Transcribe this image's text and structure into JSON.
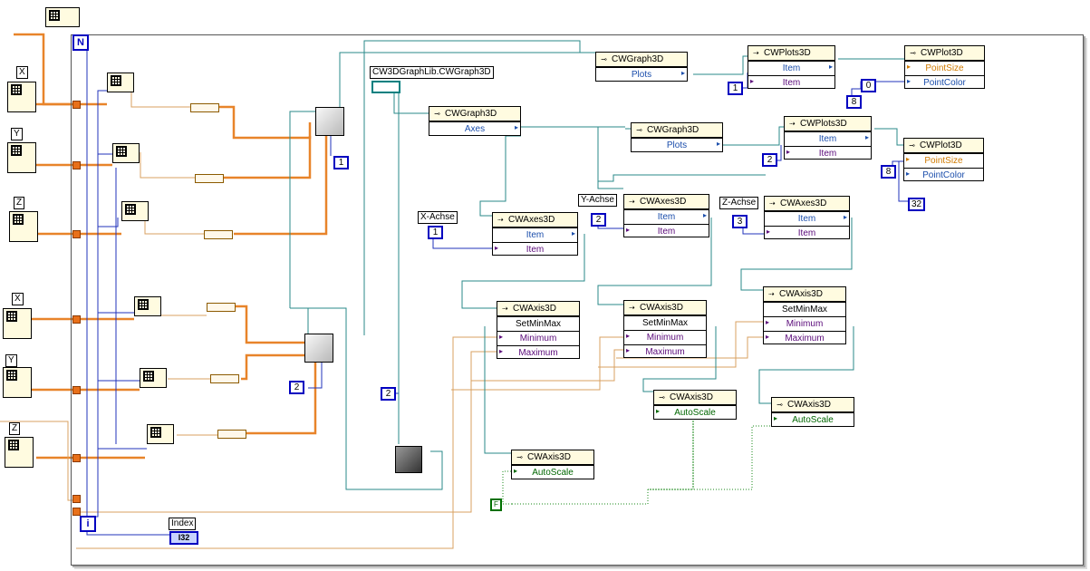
{
  "loop": {
    "count_terminal": "N",
    "iteration_terminal": "i"
  },
  "graph_ref_label": "CW3DGraphLib.CWGraph3D",
  "top_nodes": [
    {
      "class": "CWGraph3D",
      "prop": "Plots"
    },
    {
      "class": "CWPlots3D",
      "props": [
        "Item",
        "Item"
      ]
    },
    {
      "class": "CWPlot3D",
      "props": [
        "PointSize",
        "PointColor"
      ]
    },
    {
      "class": "CWGraph3D",
      "prop": "Plots"
    },
    {
      "class": "CWPlots3D",
      "props": [
        "Item",
        "Item"
      ]
    },
    {
      "class": "CWPlot3D",
      "props": [
        "PointSize",
        "PointColor"
      ]
    }
  ],
  "axes_node": {
    "class": "CWGraph3D",
    "prop": "Axes"
  },
  "axes_items": [
    {
      "label": "X-Achse",
      "class": "CWAxes3D",
      "props": [
        "Item",
        "Item"
      ],
      "const": "1"
    },
    {
      "label": "Y-Achse",
      "class": "CWAxes3D",
      "props": [
        "Item",
        "Item"
      ],
      "const": "2"
    },
    {
      "label": "Z-Achse",
      "class": "CWAxes3D",
      "props": [
        "Item",
        "Item"
      ],
      "const": "3"
    }
  ],
  "axis_minmax": [
    {
      "class": "CWAxis3D",
      "method": "SetMinMax",
      "params": [
        "Minimum",
        "Maximum"
      ]
    },
    {
      "class": "CWAxis3D",
      "method": "SetMinMax",
      "params": [
        "Minimum",
        "Maximum"
      ]
    },
    {
      "class": "CWAxis3D",
      "method": "SetMinMax",
      "params": [
        "Minimum",
        "Maximum"
      ]
    }
  ],
  "axis_autoscale": [
    {
      "class": "CWAxis3D",
      "prop": "AutoScale"
    },
    {
      "class": "CWAxis3D",
      "prop": "AutoScale"
    },
    {
      "class": "CWAxis3D",
      "prop": "AutoScale"
    }
  ],
  "constants": {
    "plot1_item": "1",
    "plot2_item": "2",
    "point_size1": "8",
    "point_color1": "0",
    "point_size2": "8",
    "point_color2": "32",
    "build1": "1",
    "build2": "2",
    "misc2": "2"
  },
  "cluster_labels": [
    "X",
    "Y",
    "Z",
    "X",
    "Y",
    "Z"
  ],
  "index_indicator": {
    "label": "Index",
    "type": "I32"
  },
  "bool_const": "F"
}
